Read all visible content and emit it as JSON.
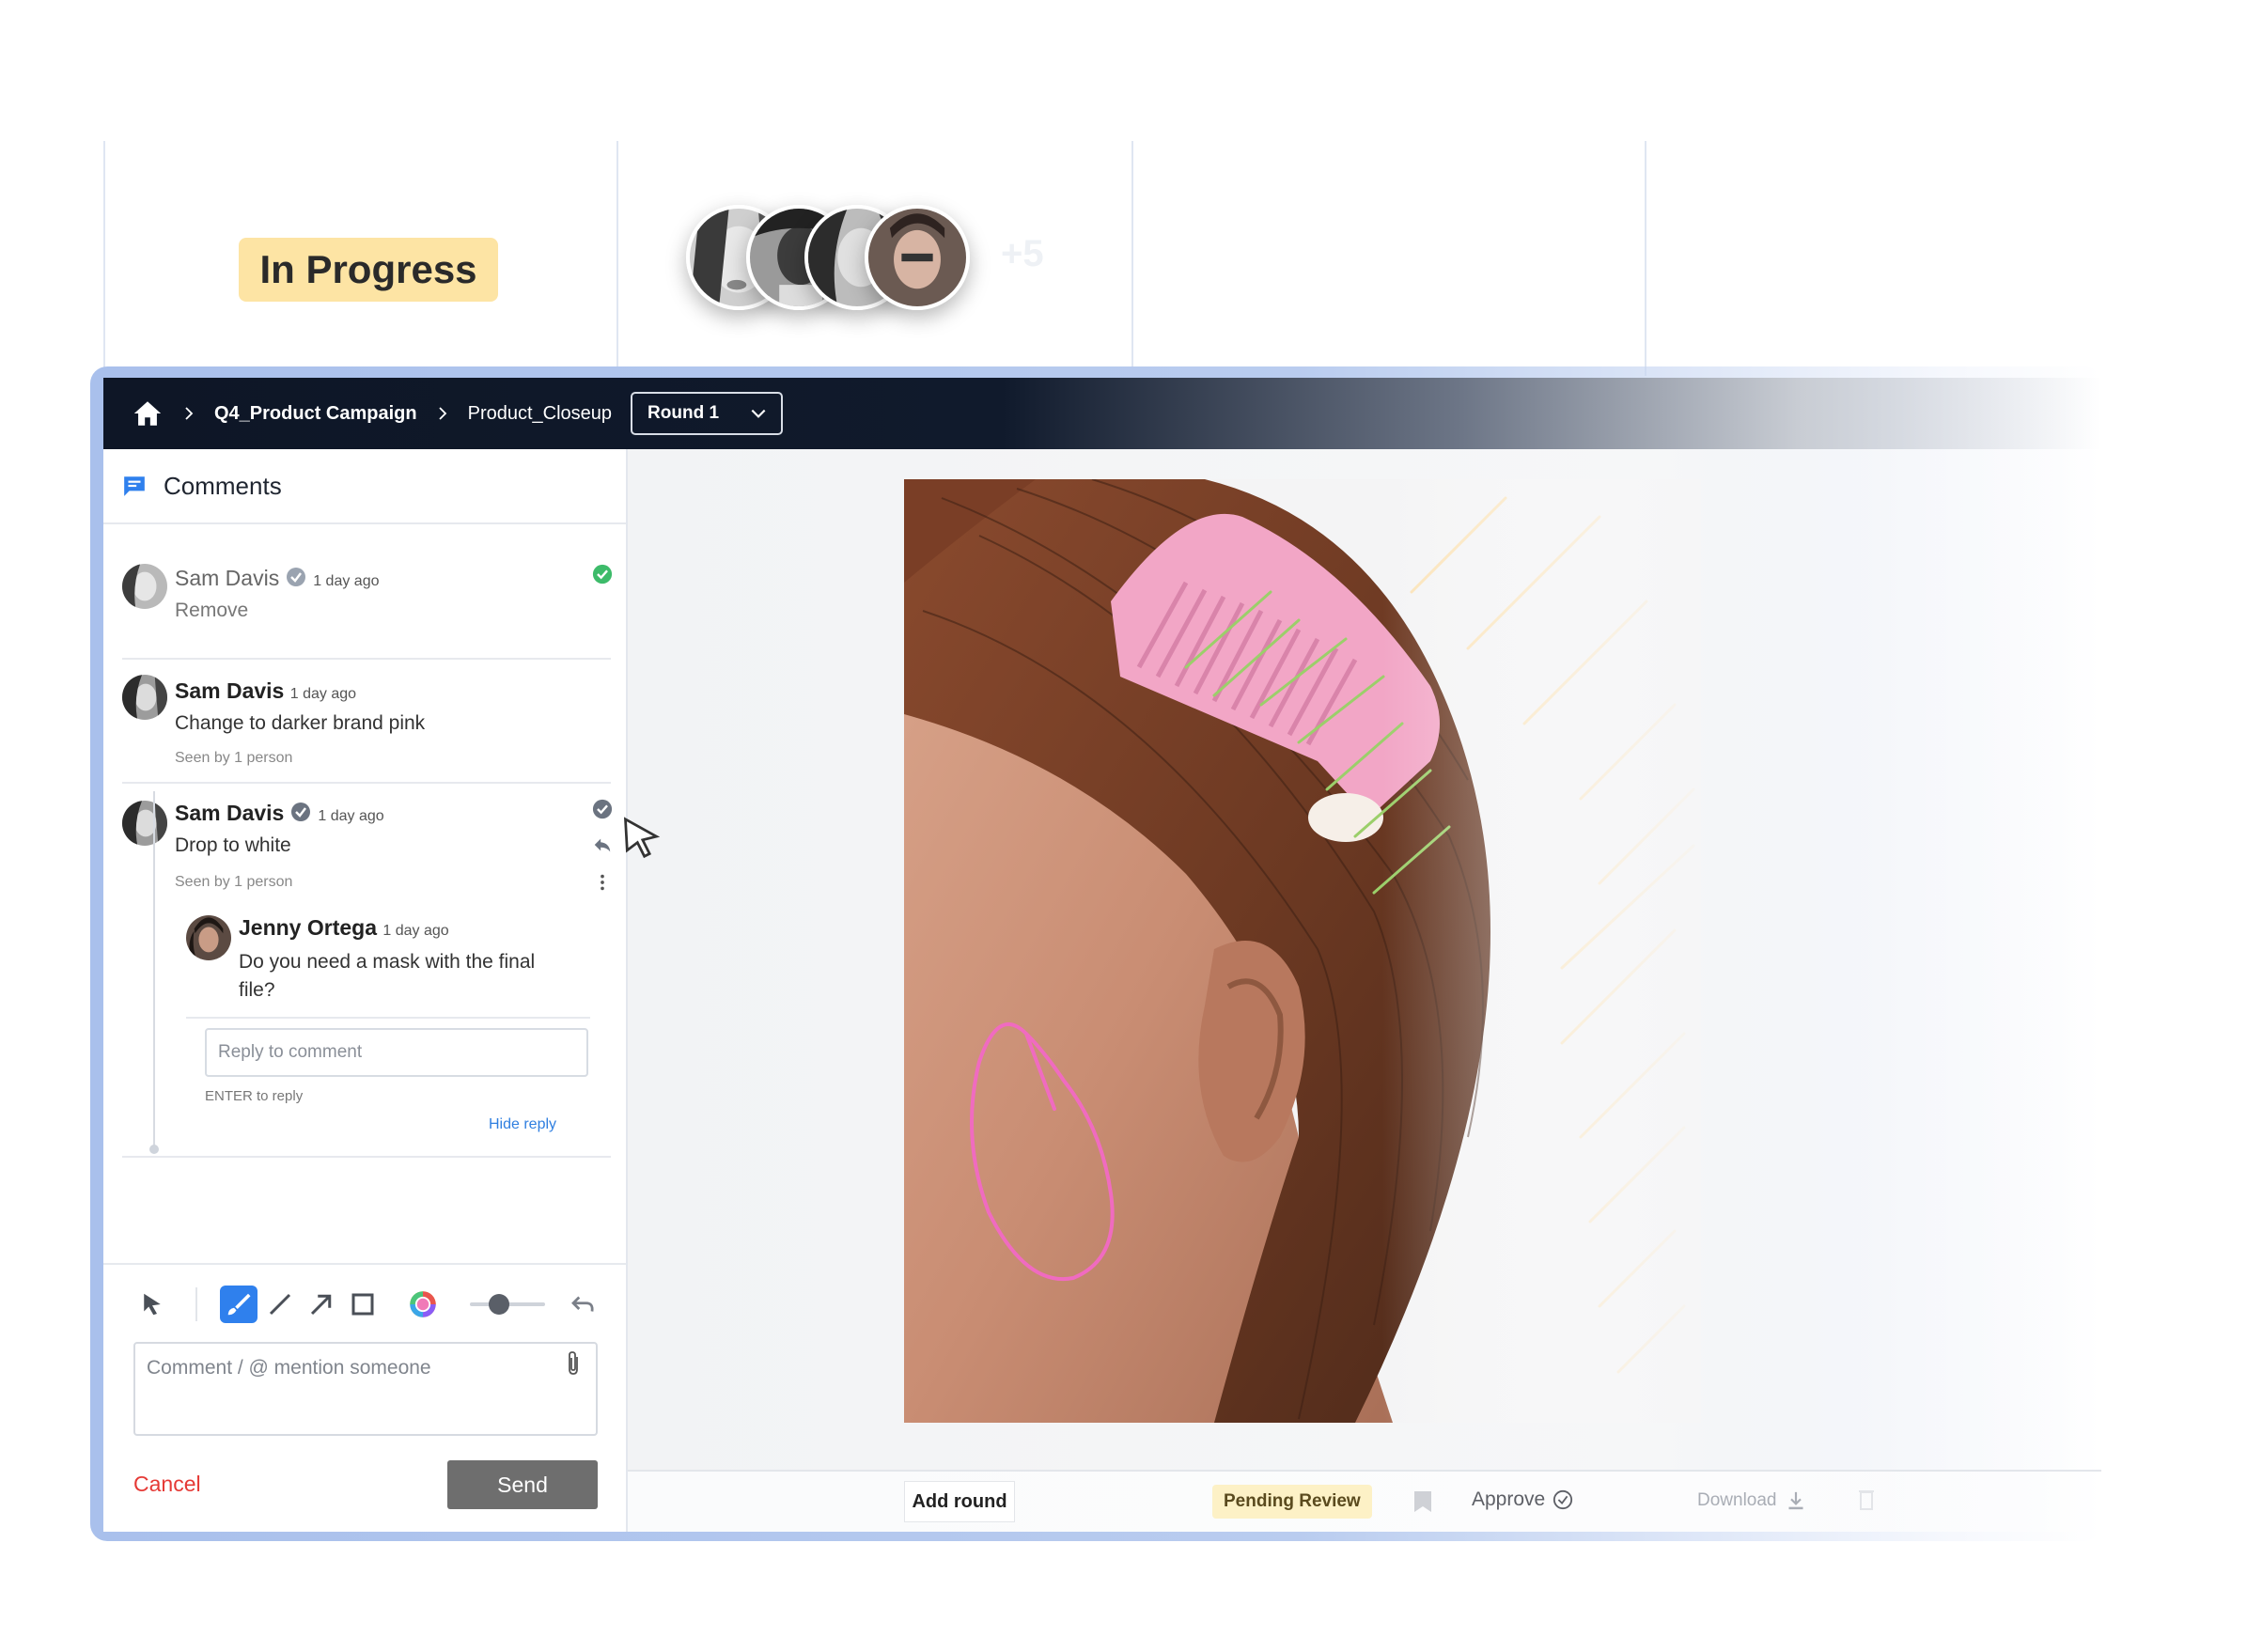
{
  "board": {
    "status_label": "In Progress",
    "more_count": "+5"
  },
  "topbar": {
    "project": "Q4_Product Campaign",
    "asset": "Product_Closeup",
    "round_label": "Round 1"
  },
  "comments_panel": {
    "title": "Comments",
    "items": [
      {
        "author": "Sam Davis",
        "time": "1 day ago",
        "text": "Remove"
      },
      {
        "author": "Sam Davis",
        "time": "1 day ago",
        "text": "Change to darker brand pink",
        "seen": "Seen by 1 person"
      },
      {
        "author": "Sam Davis",
        "time": "1 day ago",
        "text": "Drop to white",
        "seen": "Seen by 1 person",
        "reply": {
          "author": "Jenny Ortega",
          "time": "1 day ago",
          "text_line1": "Do you need a mask with the final",
          "text_line2": "file?"
        }
      }
    ],
    "reply_placeholder": "Reply to comment",
    "enter_hint": "ENTER to reply",
    "hide_reply": "Hide reply"
  },
  "composer": {
    "placeholder": "Comment / @ mention someone",
    "cancel_label": "Cancel",
    "send_label": "Send"
  },
  "bottombar": {
    "add_round": "Add round",
    "status": "Pending Review",
    "approve": "Approve",
    "download": "Download"
  },
  "colors": {
    "accent": "#2f80ed",
    "status_yellow": "#fde4a4",
    "annotation_pink": "#f06bc0",
    "annotation_green": "#9bcf6a",
    "resolved_green": "#3dbb6a"
  },
  "icons": [
    "home-icon",
    "chevron-right-icon",
    "chevron-down-icon",
    "comment-icon",
    "verified-icon",
    "check-circle-icon",
    "reply-icon",
    "more-vertical-icon",
    "select-arrow-icon",
    "brush-icon",
    "line-icon",
    "arrow-tool-icon",
    "rectangle-icon",
    "color-wheel-icon",
    "undo-icon",
    "paperclip-icon",
    "flag-icon",
    "download-icon",
    "trash-icon",
    "mouse-cursor-icon"
  ]
}
